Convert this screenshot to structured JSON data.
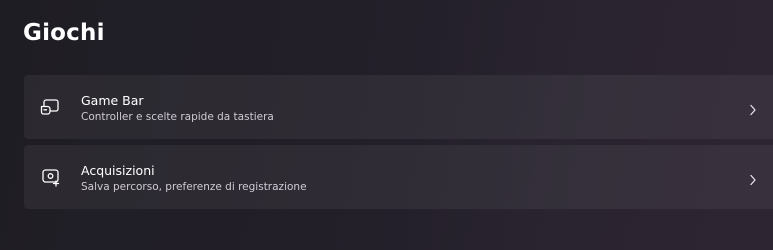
{
  "page": {
    "title": "Giochi"
  },
  "items": [
    {
      "title": "Game Bar",
      "subtitle": "Controller e scelte rapide da tastiera",
      "icon": "game-bar-icon"
    },
    {
      "title": "Acquisizioni",
      "subtitle": "Salva percorso, preferenze di registrazione",
      "icon": "captures-icon"
    }
  ],
  "colors": {
    "background": "#221f29",
    "card": "#2f2c35",
    "text": "#ffffff",
    "subtext": "#cfcbd4"
  }
}
